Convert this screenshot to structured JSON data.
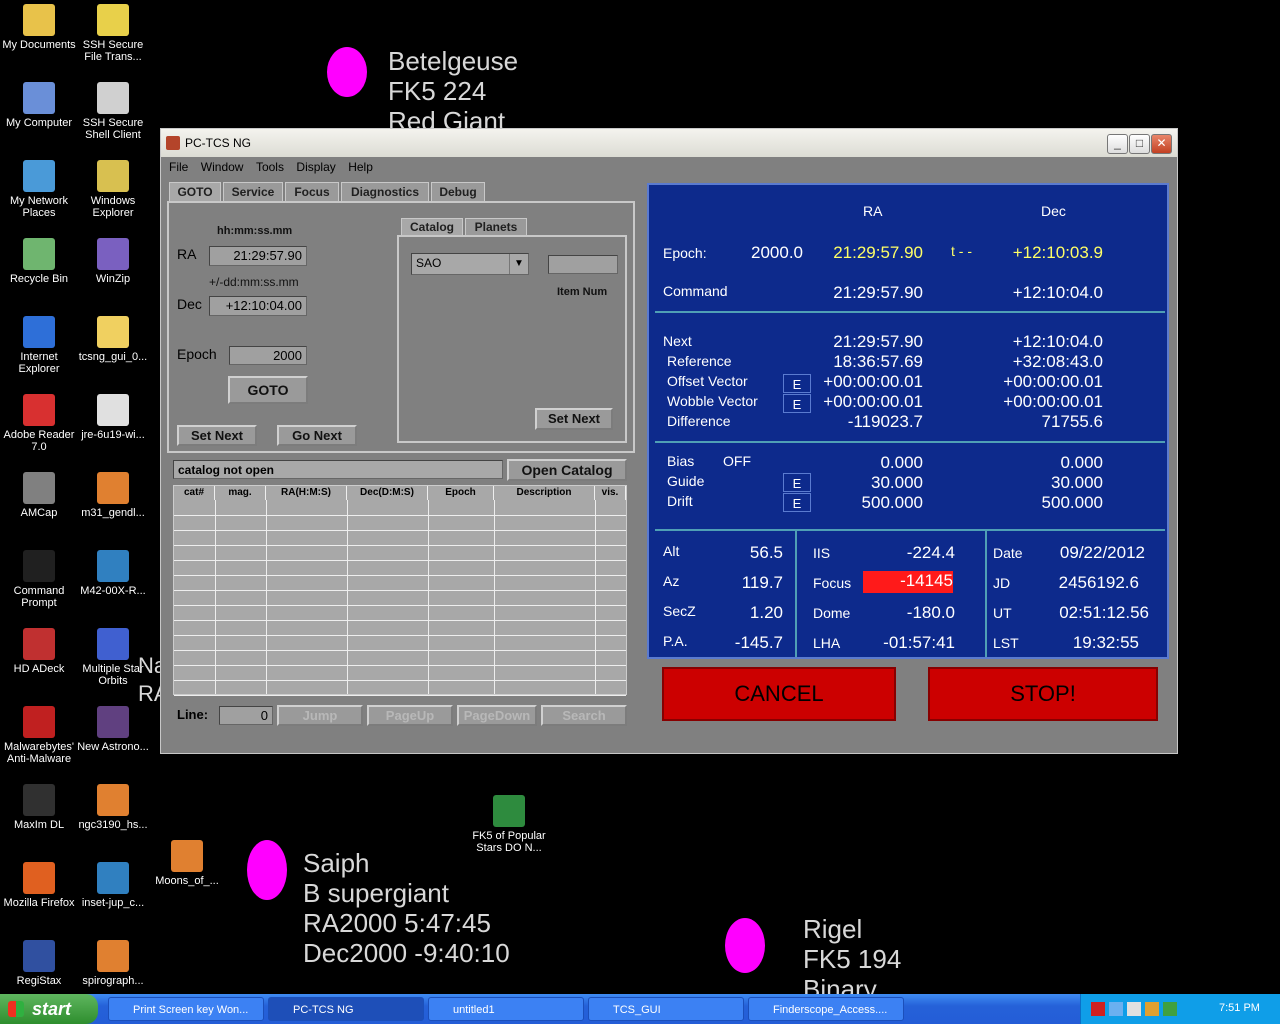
{
  "desktop": {
    "icons": [
      {
        "label": "My Documents",
        "color": "#e8c24a"
      },
      {
        "label": "SSH Secure File Trans...",
        "color": "#e8d04a"
      },
      {
        "label": "My Computer",
        "color": "#6a8fd8"
      },
      {
        "label": "SSH Secure Shell Client",
        "color": "#d0d0d0"
      },
      {
        "label": "My Network Places",
        "color": "#4a9ad8"
      },
      {
        "label": "Windows Explorer",
        "color": "#d8c050"
      },
      {
        "label": "Recycle Bin",
        "color": "#6fb56f"
      },
      {
        "label": "WinZip",
        "color": "#7a60c0"
      },
      {
        "label": "Internet Explorer",
        "color": "#2e6fd8"
      },
      {
        "label": "tcsng_gui_0...",
        "color": "#f0d060"
      },
      {
        "label": "Adobe Reader 7.0",
        "color": "#d83030"
      },
      {
        "label": "jre-6u19-wi...",
        "color": "#e0e0e0"
      },
      {
        "label": "AMCap",
        "color": "#808080"
      },
      {
        "label": "m31_gendl...",
        "color": "#e08030"
      },
      {
        "label": "Command Prompt",
        "color": "#202020"
      },
      {
        "label": "M42-00X-R...",
        "color": "#3080c0"
      },
      {
        "label": "HD ADeck",
        "color": "#c03030"
      },
      {
        "label": "Multiple Star Orbits",
        "color": "#4060d0"
      },
      {
        "label": "Malwarebytes' Anti-Malware",
        "color": "#c02020"
      },
      {
        "label": "New Astrono...",
        "color": "#604080"
      },
      {
        "label": "MaxIm DL",
        "color": "#303030"
      },
      {
        "label": "ngc3190_hs...",
        "color": "#e08030"
      },
      {
        "label": "Mozilla Firefox",
        "color": "#e06020"
      },
      {
        "label": "inset-jup_c...",
        "color": "#3080c0"
      },
      {
        "label": "Moons_of_...",
        "color": "#e08030"
      },
      {
        "label": "RegiStax",
        "color": "#3050a0"
      },
      {
        "label": "spirograph...",
        "color": "#e08030"
      },
      {
        "label": "FK5 of Popular Stars DO N...",
        "color": "#2e8b3e"
      }
    ],
    "stars": {
      "betelgeuse": [
        "Betelgeuse",
        "FK5 224",
        "Red Giant"
      ],
      "saiph": [
        "Saiph",
        "B supergiant",
        "RA2000 5:47:45",
        "Dec2000 -9:40:10"
      ],
      "rigel": [
        "Rigel",
        "FK5 194",
        "Binary"
      ],
      "partial": [
        "Na",
        "RA"
      ]
    }
  },
  "window": {
    "title": "PC-TCS NG",
    "menu": [
      "File",
      "Window",
      "Tools",
      "Display",
      "Help"
    ],
    "tabs": [
      "GOTO",
      "Service",
      "Focus",
      "Diagnostics",
      "Debug"
    ],
    "goto": {
      "ra_format": "hh:mm:ss.mm",
      "ra_label": "RA",
      "ra_value": "21:29:57.90",
      "dec_format": "+/-dd:mm:ss.mm",
      "dec_label": "Dec",
      "dec_value": "+12:10:04.00",
      "epoch_label": "Epoch",
      "epoch_value": "2000",
      "goto_button": "GOTO",
      "set_next": "Set Next",
      "go_next": "Go Next"
    },
    "catalog": {
      "tabs": [
        "Catalog",
        "Planets"
      ],
      "selected": "SAO",
      "item_num_label": "Item Num",
      "item_num_value": "",
      "set_next": "Set Next",
      "status": "catalog not open",
      "open_button": "Open Catalog",
      "columns": [
        "cat#",
        "mag.",
        "RA(H:M:S)",
        "Dec(D:M:S)",
        "Epoch",
        "Description",
        "vis."
      ],
      "line_label": "Line:",
      "line_value": "0",
      "nav": [
        "Jump",
        "PageUp",
        "PageDown",
        "Search"
      ]
    },
    "status": {
      "col_ra": "RA",
      "col_dec": "Dec",
      "epoch_label": "Epoch:",
      "epoch_value": "2000.0",
      "epoch_ra": "21:29:57.90",
      "epoch_mid": "t - -",
      "epoch_dec": "+12:10:03.9",
      "command_label": "Command",
      "command_ra": "21:29:57.90",
      "command_dec": "+12:10:04.0",
      "rows": [
        {
          "label": "Next",
          "ra": "21:29:57.90",
          "dec": "+12:10:04.0",
          "e": false
        },
        {
          "label": "Reference",
          "ra": "18:36:57.69",
          "dec": "+32:08:43.0",
          "e": false
        },
        {
          "label": "Offset Vector",
          "ra": "+00:00:00.01",
          "dec": "+00:00:00.01",
          "e": true
        },
        {
          "label": "Wobble Vector",
          "ra": "+00:00:00.01",
          "dec": "+00:00:00.01",
          "e": true
        },
        {
          "label": "Difference",
          "ra": "-119023.7",
          "dec": "71755.6",
          "e": false
        }
      ],
      "bias_label": "Bias",
      "bias_state": "OFF",
      "bias_ra": "0.000",
      "bias_dec": "0.000",
      "guide_label": "Guide",
      "guide_ra": "30.000",
      "guide_dec": "30.000",
      "drift_label": "Drift",
      "drift_ra": "500.000",
      "drift_dec": "500.000",
      "e_label": "E",
      "alt_label": "Alt",
      "alt": "56.5",
      "az_label": "Az",
      "az": "119.7",
      "secz_label": "SecZ",
      "secz": "1.20",
      "pa_label": "P.A.",
      "pa": "-145.7",
      "iis_label": "IIS",
      "iis": "-224.4",
      "focus_label": "Focus",
      "focus": "-14145",
      "dome_label": "Dome",
      "dome": "-180.0",
      "lha_label": "LHA",
      "lha": "-01:57:41",
      "date_label": "Date",
      "date": "09/22/2012",
      "jd_label": "JD",
      "jd": "2456192.6",
      "ut_label": "UT",
      "ut": "02:51:12.56",
      "lst_label": "LST",
      "lst": "19:32:55"
    },
    "cancel": "CANCEL",
    "stop": "STOP!"
  },
  "taskbar": {
    "start": "start",
    "tasks": [
      "Print Screen key Won...",
      "PC-TCS NG",
      "untitled1",
      "TCS_GUI",
      "Finderscope_Access...."
    ],
    "clock": "7:51 PM"
  }
}
